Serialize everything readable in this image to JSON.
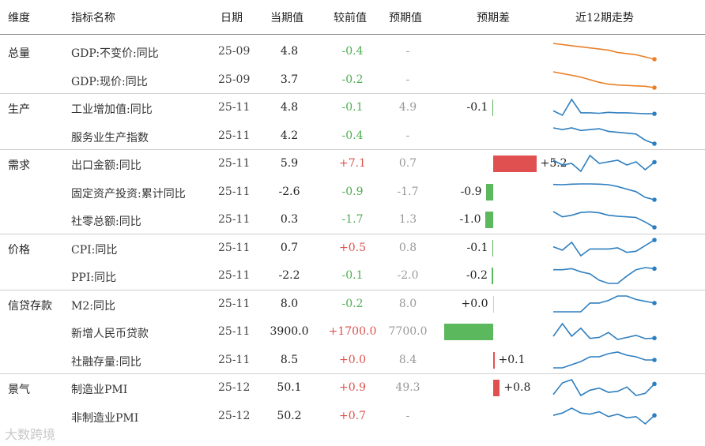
{
  "headers": {
    "category": "维度",
    "name": "指标名称",
    "date": "日期",
    "current": "当期值",
    "change": "较前值",
    "expected": "预期值",
    "diff": "预期差",
    "trend": "近12期走势"
  },
  "rows": [
    {
      "cat": "总量",
      "name": "GDP:不变价:同比",
      "date": "25-09",
      "cur": "4.8",
      "chg": "-0.4",
      "chg_dir": "neg",
      "exp": "-",
      "diff": null,
      "diff_label": "",
      "spark_color": "#e8812a",
      "spark": [
        6.2,
        6.1,
        6.0,
        5.9,
        5.8,
        5.7,
        5.6,
        5.4,
        5.3,
        5.2,
        5.0,
        4.8
      ]
    },
    {
      "cat": "",
      "name": "GDP:现价:同比",
      "date": "25-09",
      "cur": "3.7",
      "chg": "-0.2",
      "chg_dir": "neg",
      "exp": "-",
      "diff": null,
      "diff_label": "",
      "spark_color": "#e8812a",
      "spark": [
        5.5,
        5.3,
        5.1,
        4.9,
        4.6,
        4.3,
        4.1,
        4.0,
        3.95,
        3.9,
        3.85,
        3.7
      ]
    },
    {
      "cat": "生产",
      "name": "工业增加值:同比",
      "date": "25-11",
      "cur": "4.8",
      "chg": "-0.1",
      "chg_dir": "neg",
      "exp": "4.9",
      "diff": -0.1,
      "diff_label": "-0.1",
      "spark_color": "#2f7fbf",
      "spark": [
        5.4,
        4.5,
        7.7,
        5.0,
        5.0,
        4.9,
        5.1,
        5.0,
        5.0,
        4.9,
        4.8,
        4.8
      ]
    },
    {
      "cat": "",
      "name": "服务业生产指数",
      "date": "25-11",
      "cur": "4.2",
      "chg": "-0.4",
      "chg_dir": "neg",
      "exp": "-",
      "diff": null,
      "diff_label": "",
      "spark_color": "#2f7fbf",
      "spark": [
        6.0,
        5.8,
        6.0,
        5.7,
        5.8,
        5.9,
        5.6,
        5.5,
        5.4,
        5.3,
        4.6,
        4.2
      ]
    },
    {
      "cat": "需求",
      "name": "出口金额:同比",
      "date": "25-11",
      "cur": "5.9",
      "chg": "+7.1",
      "chg_dir": "pos",
      "exp": "0.7",
      "diff": 5.2,
      "diff_label": "+5.2",
      "spark_color": "#2f7fbf",
      "spark": [
        6.5,
        5.0,
        5.5,
        3.0,
        8.0,
        5.5,
        6.0,
        6.5,
        5.0,
        6.0,
        3.5,
        5.9
      ]
    },
    {
      "cat": "",
      "name": "固定资产投资:累计同比",
      "date": "25-11",
      "cur": "-2.6",
      "chg": "-0.9",
      "chg_dir": "neg",
      "exp": "-1.7",
      "diff": -0.9,
      "diff_label": "-0.9",
      "spark_color": "#2f7fbf",
      "spark": [
        3.3,
        3.2,
        3.4,
        3.5,
        3.5,
        3.4,
        3.2,
        2.5,
        1.5,
        0.5,
        -1.7,
        -2.6
      ]
    },
    {
      "cat": "",
      "name": "社零总额:同比",
      "date": "25-11",
      "cur": "0.3",
      "chg": "-1.7",
      "chg_dir": "neg",
      "exp": "1.3",
      "diff": -1.0,
      "diff_label": "-1.0",
      "spark_color": "#2f7fbf",
      "spark": [
        5.4,
        3.7,
        4.2,
        5.1,
        5.3,
        5.0,
        4.2,
        3.9,
        3.7,
        3.5,
        2.0,
        0.3
      ]
    },
    {
      "cat": "价格",
      "name": "CPI:同比",
      "date": "25-11",
      "cur": "0.7",
      "chg": "+0.5",
      "chg_dir": "pos",
      "exp": "0.8",
      "diff": -0.1,
      "diff_label": "-0.1",
      "spark_color": "#2f7fbf",
      "spark": [
        0.1,
        -0.2,
        0.5,
        -0.7,
        -0.1,
        -0.1,
        -0.1,
        0.0,
        -0.4,
        -0.3,
        0.2,
        0.7
      ]
    },
    {
      "cat": "",
      "name": "PPI:同比",
      "date": "25-11",
      "cur": "-2.2",
      "chg": "-0.1",
      "chg_dir": "neg",
      "exp": "-2.0",
      "diff": -0.2,
      "diff_label": "-0.2",
      "spark_color": "#2f7fbf",
      "spark": [
        -2.3,
        -2.3,
        -2.2,
        -2.5,
        -2.7,
        -3.3,
        -3.6,
        -3.6,
        -2.9,
        -2.3,
        -2.1,
        -2.2
      ]
    },
    {
      "cat": "信贷存款",
      "name": "M2:同比",
      "date": "25-11",
      "cur": "8.0",
      "chg": "-0.2",
      "chg_dir": "neg",
      "exp": "8.0",
      "diff": 0.0,
      "diff_label": "+0.0",
      "spark_color": "#2f7fbf",
      "spark": [
        7.0,
        7.0,
        7.0,
        7.0,
        8.0,
        8.0,
        8.3,
        8.8,
        8.8,
        8.4,
        8.2,
        8.0
      ]
    },
    {
      "cat": "",
      "name": "新增人民币贷款",
      "date": "25-11",
      "cur": "3900.0",
      "chg": "+1700.0",
      "chg_dir": "pos",
      "exp": "7700.0",
      "diff": -3800,
      "diff_label": "",
      "spark_color": "#2f7fbf",
      "spark": [
        9900,
        51300,
        10100,
        36400,
        2800,
        6200,
        22400,
        -500,
        5900,
        12900,
        2200,
        3900
      ]
    },
    {
      "cat": "",
      "name": "社融存量:同比",
      "date": "25-11",
      "cur": "8.5",
      "chg": "+0.0",
      "chg_dir": "pos",
      "exp": "8.4",
      "diff": 0.1,
      "diff_label": "+0.1",
      "spark_color": "#2f7fbf",
      "spark": [
        8.0,
        8.0,
        8.2,
        8.4,
        8.7,
        8.7,
        8.9,
        9.0,
        8.8,
        8.7,
        8.5,
        8.5
      ]
    },
    {
      "cat": "景气",
      "name": "制造业PMI",
      "date": "25-12",
      "cur": "50.1",
      "chg": "+0.9",
      "chg_dir": "pos",
      "exp": "49.3",
      "diff": 0.8,
      "diff_label": "+0.8",
      "spark_color": "#2f7fbf",
      "spark": [
        49.1,
        50.2,
        50.5,
        49.0,
        49.5,
        49.7,
        49.3,
        49.4,
        49.8,
        49.0,
        49.2,
        50.1
      ]
    },
    {
      "cat": "",
      "name": "非制造业PMI",
      "date": "25-12",
      "cur": "50.2",
      "chg": "+0.7",
      "chg_dir": "pos",
      "exp": "-",
      "diff": null,
      "diff_label": "",
      "spark_color": "#2f7fbf",
      "spark": [
        50.2,
        50.4,
        50.8,
        50.4,
        50.3,
        50.5,
        50.1,
        50.3,
        50.0,
        50.1,
        49.5,
        50.2
      ]
    }
  ],
  "watermark": "大数跨境"
}
